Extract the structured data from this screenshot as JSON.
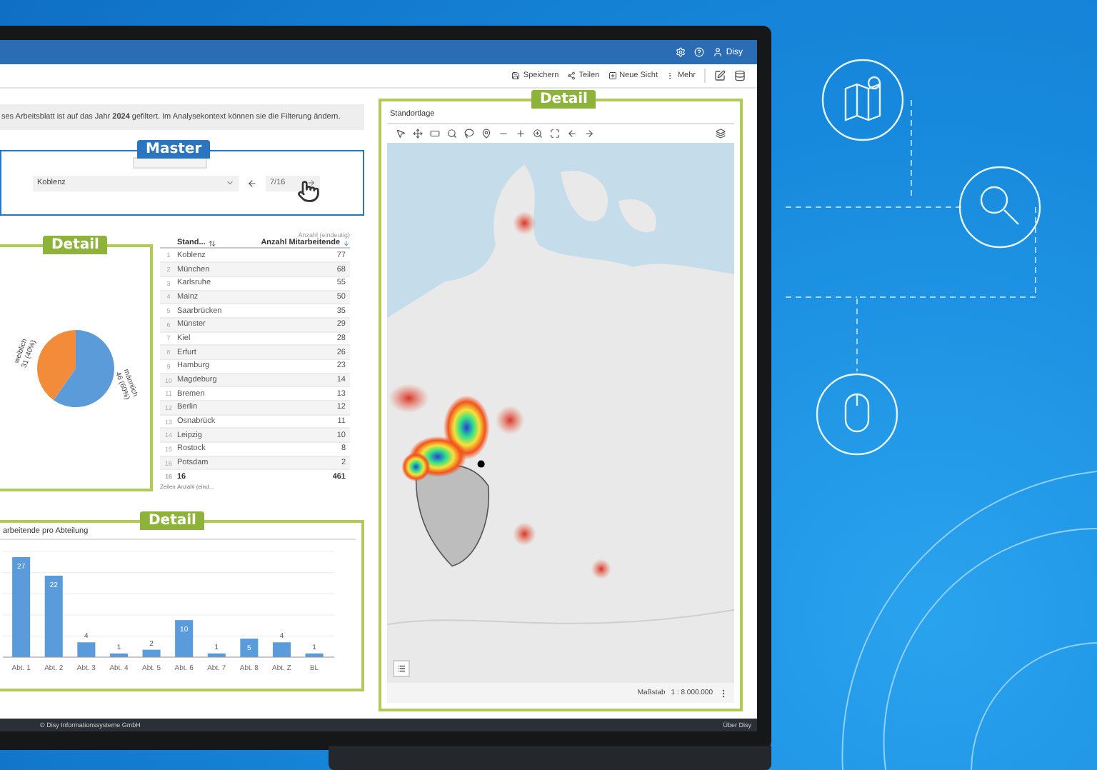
{
  "top_bar": {
    "user": "Disy"
  },
  "toolbar": {
    "actions": [
      {
        "kind": "save",
        "label": "Speichern"
      },
      {
        "kind": "share",
        "label": "Teilen"
      },
      {
        "kind": "new",
        "label": "Neue Sicht"
      },
      {
        "kind": "more",
        "label": "Mehr"
      }
    ]
  },
  "info": "ses Arbeitsblatt ist auf das Jahr **2024** gefiltert. Im Analysekontext können sie die Filterung ändern.",
  "master": {
    "badge": "Master",
    "select_value": "Koblenz",
    "position": "7/16"
  },
  "pie_panel": {
    "badge": "Detail",
    "chart_data": {
      "type": "pie",
      "categories": [
        "weiblich",
        "männlich"
      ],
      "values": [
        31,
        46
      ],
      "value_labels": [
        "31 (40%)",
        "46 (60%)"
      ]
    }
  },
  "table": {
    "columns": [
      {
        "kind": "index"
      },
      {
        "kind": "text",
        "label": "Stand..."
      },
      {
        "kind": "number",
        "sublabel": "Anzahl (eindeutig)",
        "label": "Anzahl Mitarbeitende"
      }
    ],
    "rows": [
      [
        "1",
        "Koblenz",
        "77"
      ],
      [
        "2",
        "München",
        "68"
      ],
      [
        "3",
        "Karlsruhe",
        "55"
      ],
      [
        "4",
        "Mainz",
        "50"
      ],
      [
        "5",
        "Saarbrücken",
        "35"
      ],
      [
        "6",
        "Münster",
        "29"
      ],
      [
        "7",
        "Kiel",
        "28"
      ],
      [
        "8",
        "Erfurt",
        "26"
      ],
      [
        "9",
        "Hamburg",
        "23"
      ],
      [
        "10",
        "Magdeburg",
        "14"
      ],
      [
        "11",
        "Bremen",
        "13"
      ],
      [
        "12",
        "Berlin",
        "12"
      ],
      [
        "13",
        "Osnabrück",
        "11"
      ],
      [
        "14",
        "Leipzig",
        "10"
      ],
      [
        "15",
        "Rostock",
        "8"
      ],
      [
        "16",
        "Potsdam",
        "2"
      ]
    ],
    "footer": {
      "index": "16",
      "count": "16",
      "total": "461",
      "index_label": "Zeilen",
      "count_label": "Anzahl (eind..."
    }
  },
  "bar_panel": {
    "badge": "Detail",
    "title": "arbeitende pro Abteilung",
    "chart_data": {
      "type": "bar",
      "categories": [
        "Abt. 1",
        "Abt. 2",
        "Abt. 3",
        "Abt. 4",
        "Abt. 5",
        "Abt. 6",
        "Abt. 7",
        "Abt. 8",
        "Abt. Z",
        "BL"
      ],
      "values": [
        27,
        22,
        4,
        1,
        2,
        10,
        1,
        5,
        4,
        1
      ],
      "data_labels": true
    }
  },
  "map_panel": {
    "badge": "Detail",
    "title": "Standortlage",
    "scale_label": "Maßstab",
    "scale_value": "1 : 8.000.000"
  },
  "footer": {
    "copyright": "© Disy Informationssysteme GmbH",
    "about": "Über Disy"
  }
}
